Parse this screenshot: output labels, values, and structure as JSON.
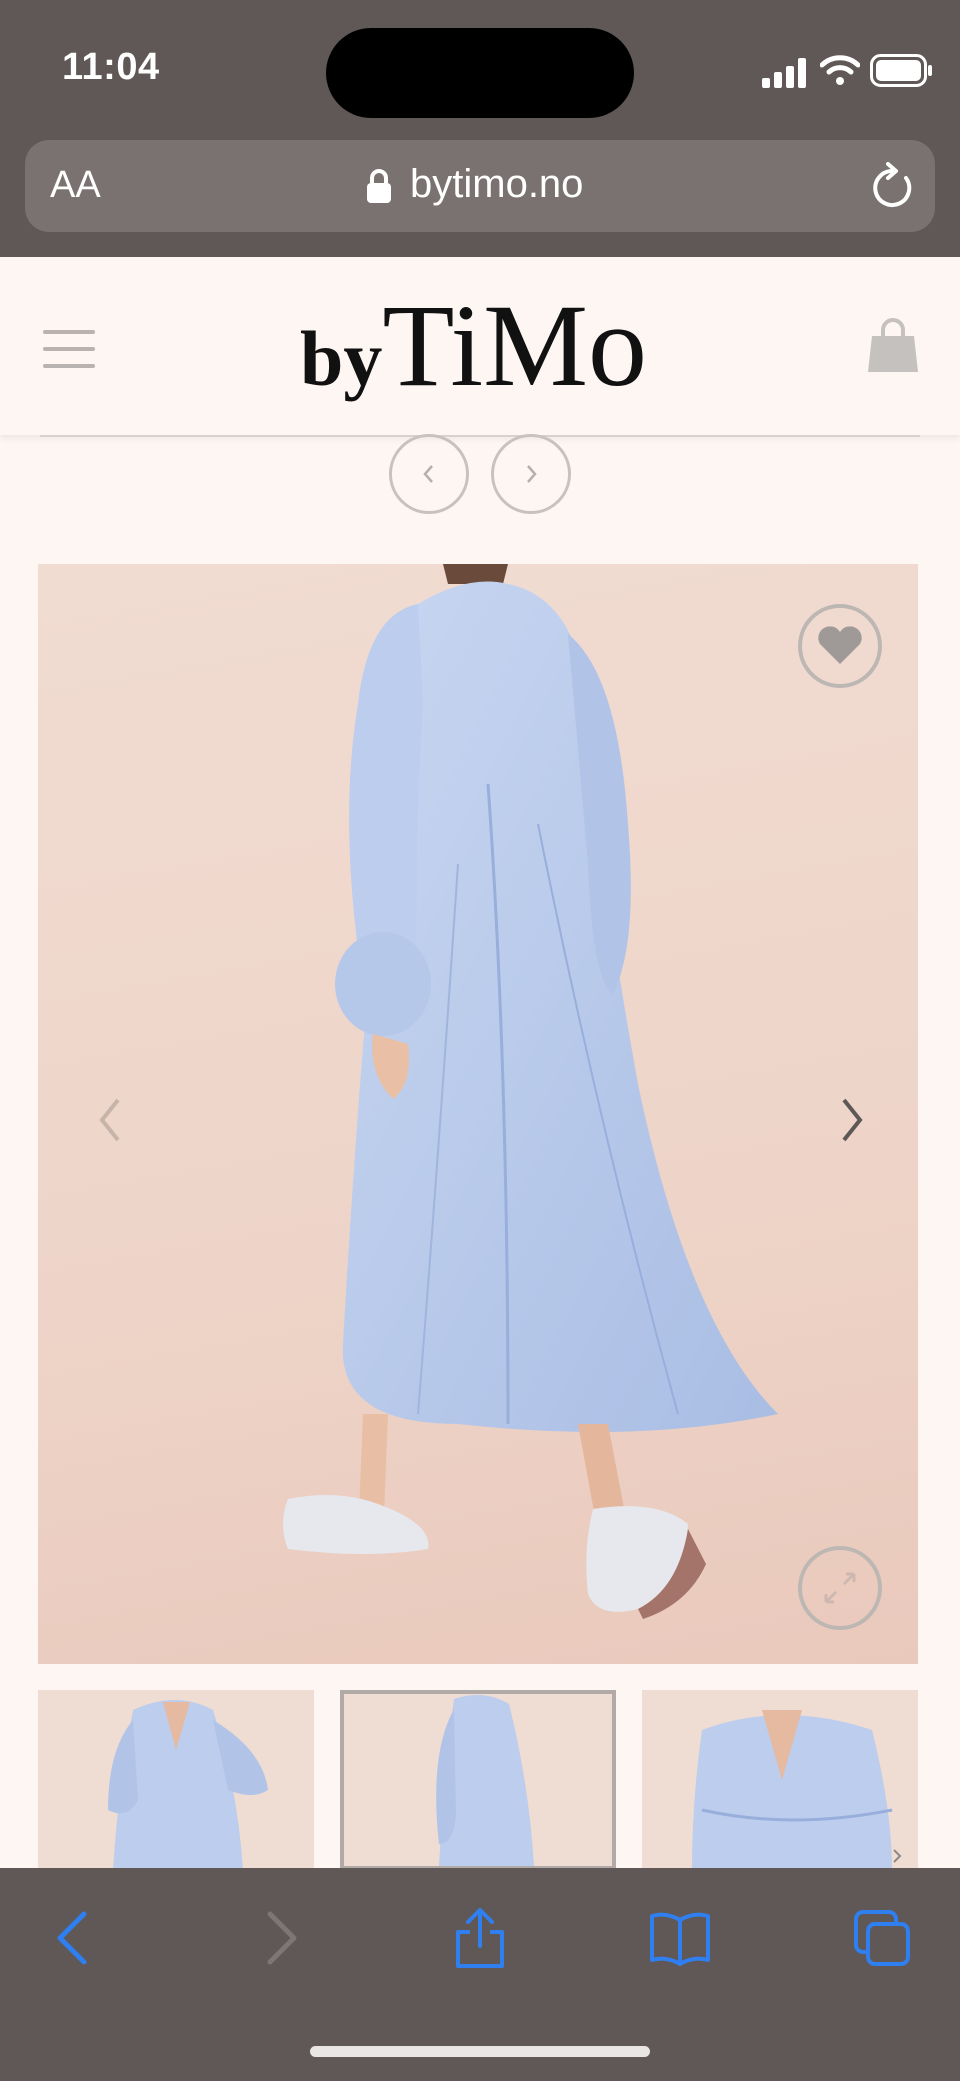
{
  "status_bar": {
    "time": "11:04"
  },
  "browser": {
    "text_size_label": "AA",
    "url": "bytimo.no"
  },
  "site": {
    "logo_small": "by",
    "logo_large": "TiMo"
  },
  "gallery": {
    "thumbnail_count": 3,
    "selected_thumbnail": 2
  },
  "colors": {
    "browser_chrome": "#5f5856",
    "page_background": "#fdf6f3",
    "safari_blue": "#2f7ff0",
    "dress_blue": "#b7c9ea"
  }
}
